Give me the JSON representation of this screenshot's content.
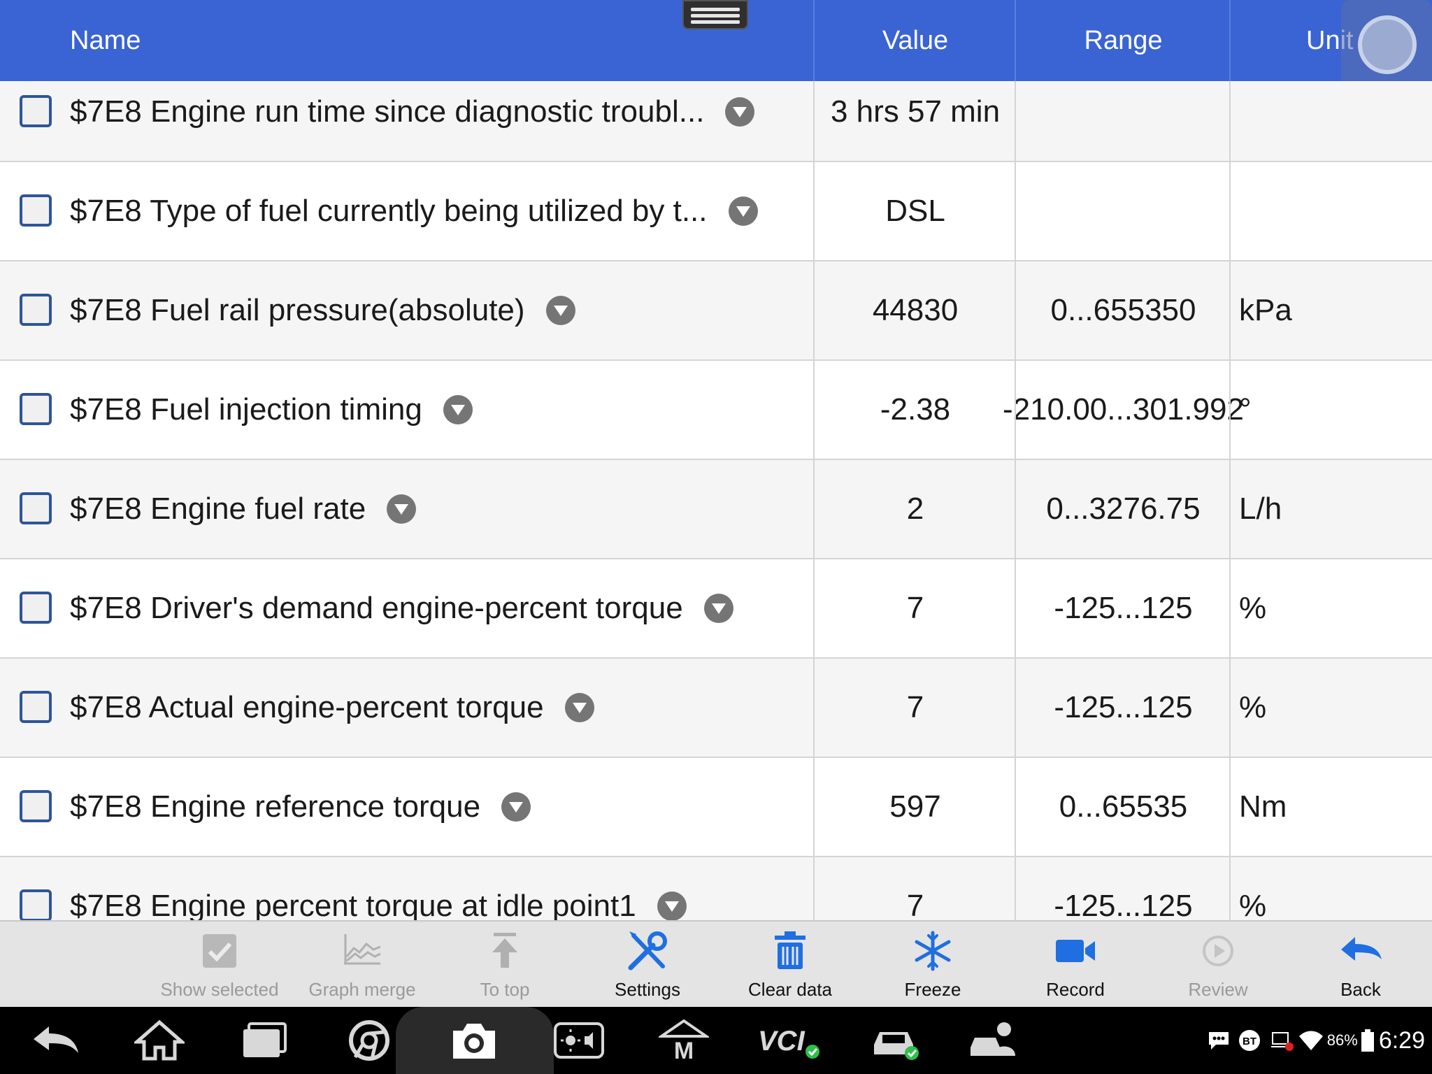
{
  "header": {
    "name_label": "Name",
    "value_label": "Value",
    "range_label": "Range",
    "unit_label": "Unit"
  },
  "rows": [
    {
      "name": "$7E8 Engine run time since diagnostic troubl...",
      "value": "3 hrs 57 min",
      "range": "",
      "unit": ""
    },
    {
      "name": "$7E8 Type of fuel currently being utilized by t...",
      "value": "DSL",
      "range": "",
      "unit": ""
    },
    {
      "name": "$7E8 Fuel rail pressure(absolute)",
      "value": "44830",
      "range": "0...655350",
      "unit": "kPa"
    },
    {
      "name": "$7E8 Fuel injection timing",
      "value": "-2.38",
      "range": "-210.00...301.992",
      "unit": "°"
    },
    {
      "name": "$7E8 Engine fuel rate",
      "value": "2",
      "range": "0...3276.75",
      "unit": "L/h"
    },
    {
      "name": "$7E8 Driver's demand engine-percent torque",
      "value": "7",
      "range": "-125...125",
      "unit": "%"
    },
    {
      "name": "$7E8 Actual engine-percent torque",
      "value": "7",
      "range": "-125...125",
      "unit": "%"
    },
    {
      "name": "$7E8 Engine reference torque",
      "value": "597",
      "range": "0...65535",
      "unit": "Nm"
    },
    {
      "name": "$7E8 Engine percent torque at idle point1",
      "value": "7",
      "range": "-125...125",
      "unit": "%"
    }
  ],
  "toolbar": {
    "show_selected": "Show selected",
    "graph_merge": "Graph merge",
    "to_top": "To top",
    "settings": "Settings",
    "clear_data": "Clear data",
    "freeze": "Freeze",
    "record": "Record",
    "review": "Review",
    "back": "Back"
  },
  "status_bar": {
    "bt_label": "BT",
    "battery": "86%",
    "time": "6:29",
    "vci_label": "VCI",
    "m_label": "M"
  },
  "colors": {
    "header": "#3a64d4",
    "accent_blue": "#1f6fe0",
    "checkbox_border": "#2f5597",
    "disabled": "#9a9a9a"
  }
}
